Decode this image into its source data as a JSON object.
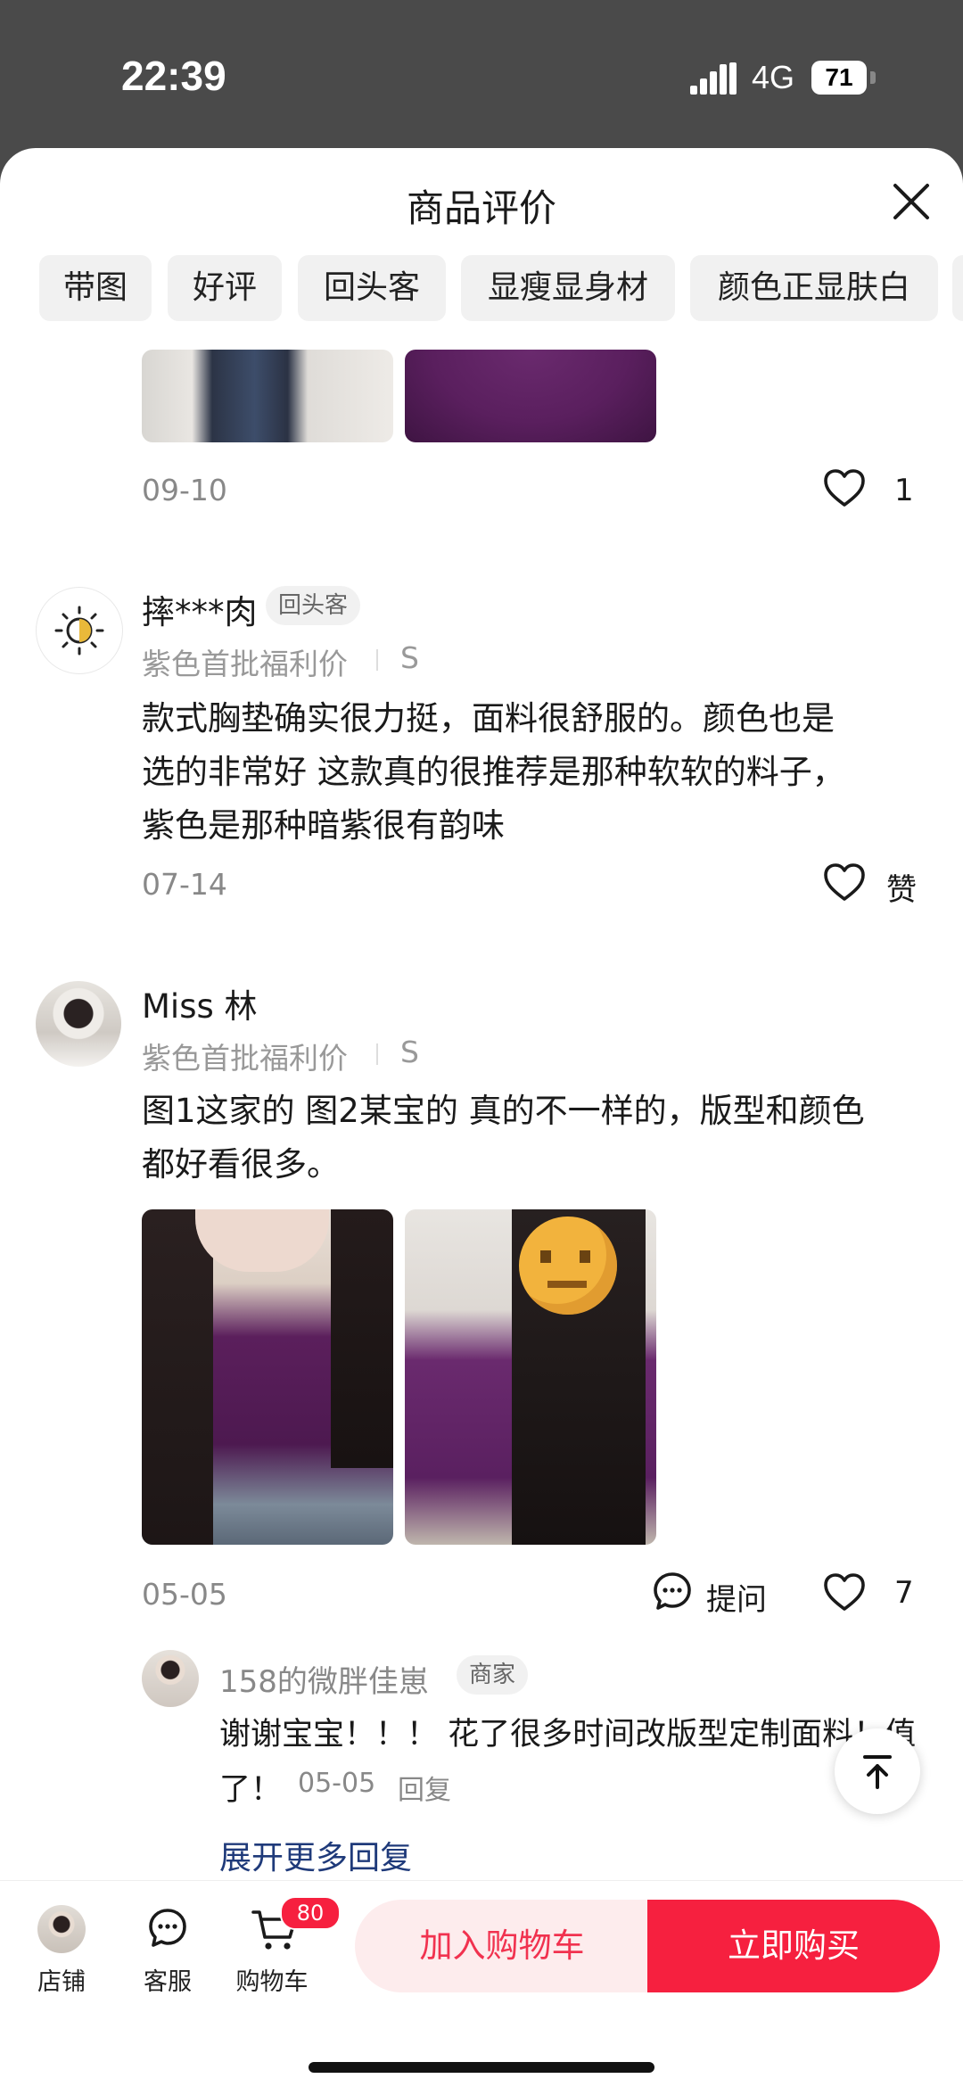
{
  "status_bar": {
    "time": "22:39",
    "network": "4G",
    "battery": "71"
  },
  "sheet": {
    "title": "商品评价"
  },
  "filters": [
    "带图",
    "好评",
    "回头客",
    "显瘦显身材",
    "颜色正显肤白"
  ],
  "reviews": [
    {
      "date": "09-10",
      "likes": "1"
    },
    {
      "user": "摔***肉",
      "badge": "回头客",
      "variant": "紫色首批福利价",
      "size": "S",
      "text_lines": [
        "款式胸垫确实很力挺，面料很舒服的。颜色也是",
        "选的非常好 这款真的很推荐是那种软软的料子，",
        "紫色是那种暗紫很有韵味"
      ],
      "date": "07-14",
      "likes": "赞"
    },
    {
      "user": "Miss 林",
      "variant": "紫色首批福利价",
      "size": "S",
      "text_lines": [
        "图1这家的 图2某宝的 真的不一样的，版型和颜色",
        "都好看很多。"
      ],
      "date": "05-05",
      "ask": "提问",
      "likes": "7",
      "reply": {
        "user": "158的微胖佳崽",
        "badge": "商家",
        "line1": "谢谢宝宝！！！ 花了很多时间改版型定制面料！值",
        "line2": "了！",
        "date": "05-05",
        "reply_label": "回复"
      },
      "expand": "展开更多回复"
    }
  ],
  "bottom_bar": {
    "store": "店铺",
    "service": "客服",
    "cart": "购物车",
    "cart_badge": "80",
    "add_to_cart": "加入购物车",
    "buy_now": "立即购买"
  },
  "colors": {
    "accent": "#f6203f",
    "accent_light": "#fdeced",
    "link": "#1f3a7a"
  }
}
